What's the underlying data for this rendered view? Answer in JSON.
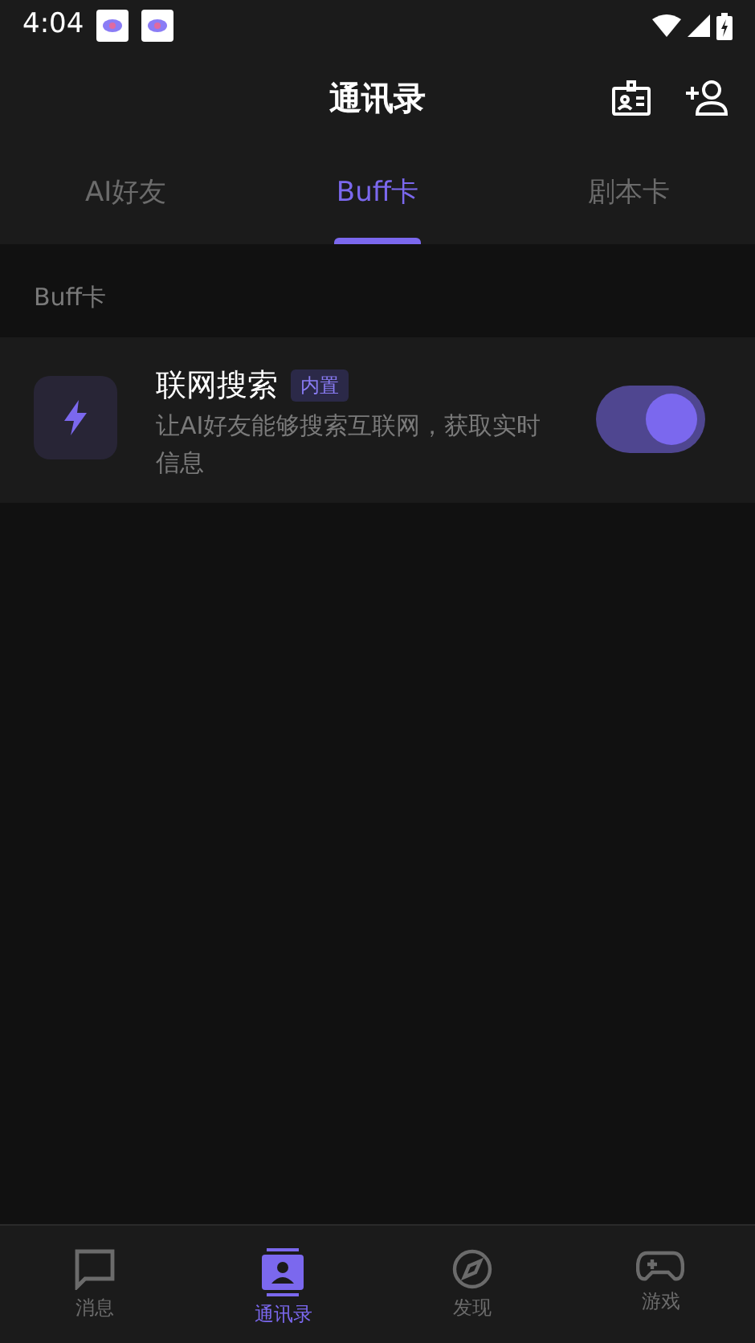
{
  "status_bar": {
    "time": "4:04"
  },
  "header": {
    "title": "通讯录"
  },
  "tabs": [
    {
      "label": "AI好友",
      "selected": false
    },
    {
      "label": "Buff卡",
      "selected": true
    },
    {
      "label": "剧本卡",
      "selected": false
    }
  ],
  "section": {
    "title": "Buff卡"
  },
  "buffs": [
    {
      "name": "联网搜索",
      "tag": "内置",
      "description": "让AI好友能够搜索互联网，获取实时信息",
      "on": true
    }
  ],
  "bottom_nav": [
    {
      "kind": "chat",
      "label": "消息",
      "selected": false
    },
    {
      "kind": "contacts",
      "label": "通讯录",
      "selected": true
    },
    {
      "kind": "compass",
      "label": "发现",
      "selected": false
    },
    {
      "kind": "game",
      "label": "游戏",
      "selected": false
    }
  ]
}
